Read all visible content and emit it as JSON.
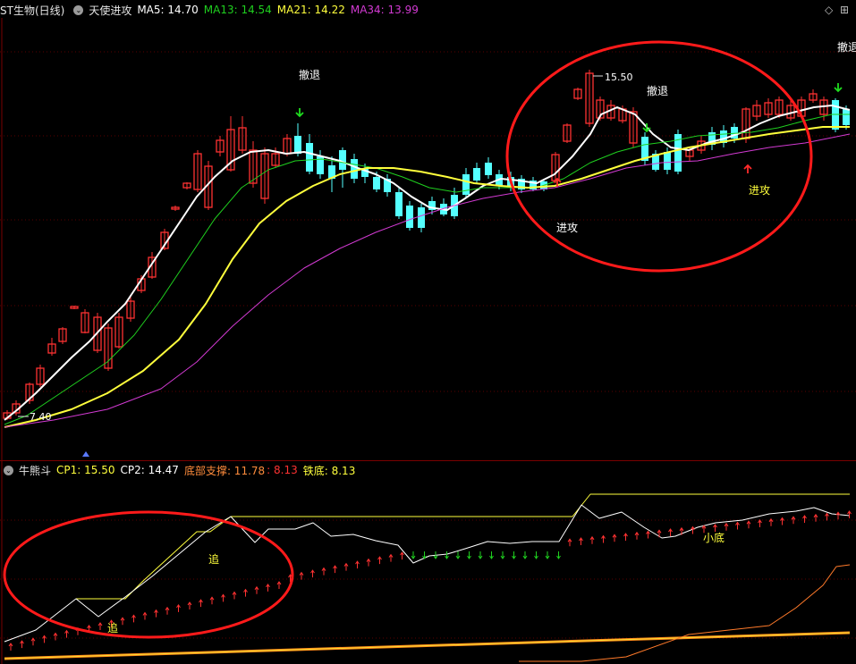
{
  "main_header": {
    "stock": "ST生物(日线)",
    "indicator": "天使进攻",
    "ma5": "MA5: 14.70",
    "ma13": "MA13: 14.54",
    "ma21": "MA21: 14.22",
    "ma34": "MA34: 13.99"
  },
  "sub_header": {
    "indicator": "牛熊斗",
    "cp1": "CP1: 15.50",
    "cp2": "CP2: 14.47",
    "bottom_support": "底部支撑: 11.78",
    "bottom_support_2": ": 8.13",
    "iron_bottom": "铁底: 8.13"
  },
  "controls": {
    "diamond": "◇",
    "expand": "⊞"
  },
  "annotations": {
    "retreat": "撤退",
    "attack": "进攻",
    "chase": "追",
    "small_bottom": "小底",
    "high_price": "15.50",
    "low_price": "7.40"
  },
  "colors": {
    "up": "#ff3232",
    "down": "#54ffff",
    "ma5": "#ffffff",
    "ma13": "#1fcf1f",
    "ma21": "#ffff3c",
    "ma34": "#d23ad2",
    "highlight_circle": "#ff1a1a"
  }
}
